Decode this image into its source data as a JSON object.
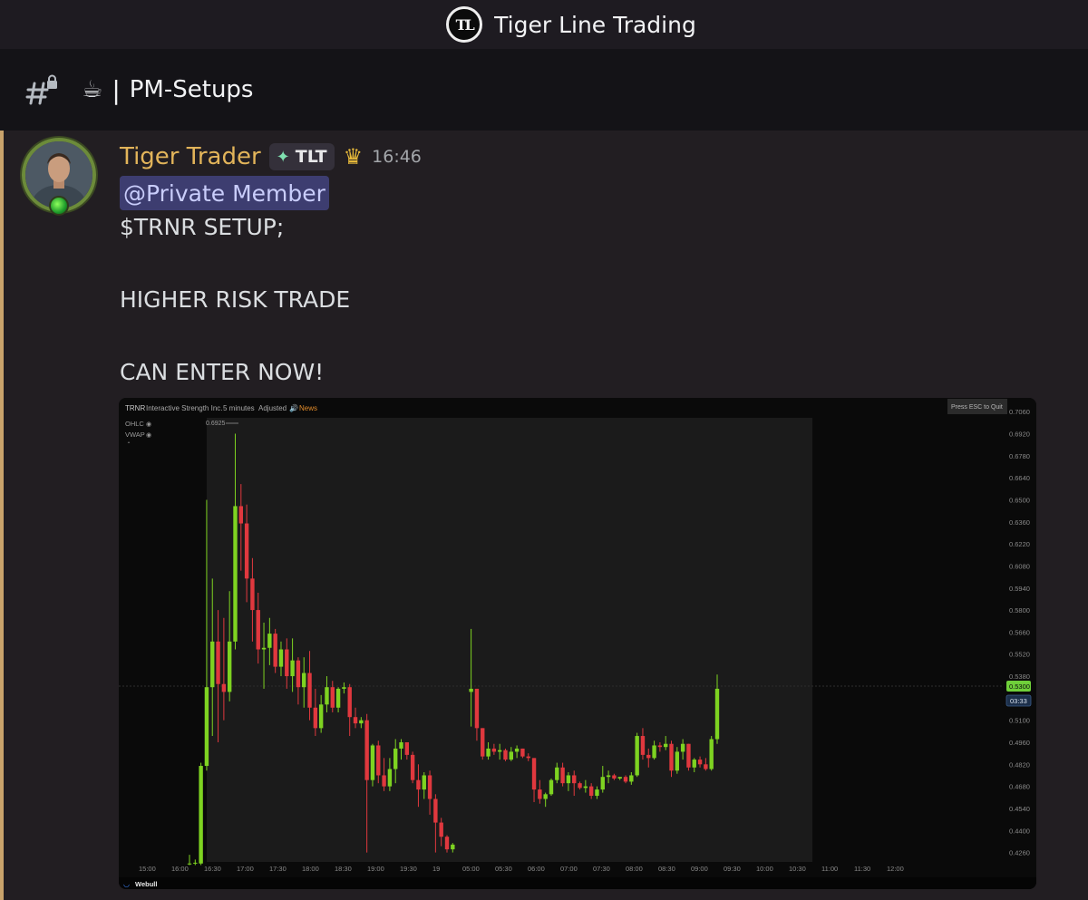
{
  "server": {
    "name": "Tiger Line Trading",
    "logo_text": "TL"
  },
  "channel": {
    "icon": "locked-hash-icon",
    "emoji": "☕",
    "separator": "|",
    "name": "PM-Setups"
  },
  "message": {
    "author": "Tiger Trader",
    "tag": "TLT",
    "timestamp": "16:46",
    "mention": "@Private Member",
    "lines": [
      "$TRNR SETUP;",
      "HIGHER RISK TRADE",
      "CAN ENTER NOW!"
    ]
  },
  "colors": {
    "author": "#e2b45a",
    "mention_bg": "#3d3d70",
    "up": "#7ed321",
    "down": "#e0383e"
  },
  "chart": {
    "symbol": "TRNR",
    "company": "Interactive Strength Inc.",
    "interval": "5 minutes",
    "adjusted": "Adjusted",
    "news": "News",
    "indicators": [
      "OHLC",
      "VWAP"
    ],
    "esc_hint": "Press ESC to Quit",
    "high_marker": "0.6925",
    "last_price": "0.5300",
    "countdown": "03:33",
    "brand": "Webull"
  },
  "chart_data": {
    "type": "candlestick",
    "title": "TRNR",
    "ylim": [
      0.42,
      0.709
    ],
    "y_ticks": [
      "0.7060",
      "0.6920",
      "0.6780",
      "0.6640",
      "0.6500",
      "0.6360",
      "0.6220",
      "0.6080",
      "0.5940",
      "0.5800",
      "0.5660",
      "0.5520",
      "0.5380",
      "0.5100",
      "0.4960",
      "0.4820",
      "0.4680",
      "0.4540",
      "0.4400",
      "0.4260"
    ],
    "x_ticks": [
      "15:00",
      "16:00",
      "16:30",
      "17:00",
      "17:30",
      "18:00",
      "18:30",
      "19:00",
      "19:30",
      "19",
      "05:00",
      "05:30",
      "06:00",
      "07:00",
      "07:30",
      "08:00",
      "08:30",
      "09:00",
      "09:30",
      "10:00",
      "10:30",
      "11:00",
      "11:30",
      "12:00"
    ],
    "candles": [
      {
        "o": 0.419,
        "h": 0.4245,
        "l": 0.418,
        "c": 0.419
      },
      {
        "o": 0.4195,
        "h": 0.4215,
        "l": 0.418,
        "c": 0.4195
      },
      {
        "o": 0.419,
        "h": 0.483,
        "l": 0.418,
        "c": 0.481
      },
      {
        "o": 0.481,
        "h": 0.65,
        "l": 0.478,
        "c": 0.531
      },
      {
        "o": 0.531,
        "h": 0.6,
        "l": 0.5,
        "c": 0.56
      },
      {
        "o": 0.56,
        "h": 0.58,
        "l": 0.496,
        "c": 0.533
      },
      {
        "o": 0.533,
        "h": 0.575,
        "l": 0.51,
        "c": 0.528
      },
      {
        "o": 0.528,
        "h": 0.592,
        "l": 0.522,
        "c": 0.56
      },
      {
        "o": 0.56,
        "h": 0.692,
        "l": 0.555,
        "c": 0.646
      },
      {
        "o": 0.646,
        "h": 0.66,
        "l": 0.605,
        "c": 0.635
      },
      {
        "o": 0.635,
        "h": 0.647,
        "l": 0.585,
        "c": 0.6
      },
      {
        "o": 0.6,
        "h": 0.613,
        "l": 0.56,
        "c": 0.58
      },
      {
        "o": 0.58,
        "h": 0.591,
        "l": 0.546,
        "c": 0.555
      },
      {
        "o": 0.555,
        "h": 0.572,
        "l": 0.53,
        "c": 0.556
      },
      {
        "o": 0.556,
        "h": 0.575,
        "l": 0.545,
        "c": 0.565
      },
      {
        "o": 0.565,
        "h": 0.568,
        "l": 0.54,
        "c": 0.544
      },
      {
        "o": 0.544,
        "h": 0.56,
        "l": 0.538,
        "c": 0.555
      },
      {
        "o": 0.555,
        "h": 0.562,
        "l": 0.53,
        "c": 0.538
      },
      {
        "o": 0.538,
        "h": 0.562,
        "l": 0.528,
        "c": 0.548
      },
      {
        "o": 0.548,
        "h": 0.55,
        "l": 0.52,
        "c": 0.531
      },
      {
        "o": 0.531,
        "h": 0.55,
        "l": 0.518,
        "c": 0.54
      },
      {
        "o": 0.54,
        "h": 0.554,
        "l": 0.51,
        "c": 0.518
      },
      {
        "o": 0.518,
        "h": 0.53,
        "l": 0.5,
        "c": 0.505
      },
      {
        "o": 0.505,
        "h": 0.526,
        "l": 0.502,
        "c": 0.52
      },
      {
        "o": 0.52,
        "h": 0.538,
        "l": 0.515,
        "c": 0.531
      },
      {
        "o": 0.531,
        "h": 0.535,
        "l": 0.515,
        "c": 0.518
      },
      {
        "o": 0.518,
        "h": 0.531,
        "l": 0.515,
        "c": 0.53
      },
      {
        "o": 0.53,
        "h": 0.534,
        "l": 0.527,
        "c": 0.531
      },
      {
        "o": 0.531,
        "h": 0.533,
        "l": 0.5,
        "c": 0.512
      },
      {
        "o": 0.512,
        "h": 0.518,
        "l": 0.505,
        "c": 0.508
      },
      {
        "o": 0.508,
        "h": 0.512,
        "l": 0.505,
        "c": 0.51
      },
      {
        "o": 0.51,
        "h": 0.514,
        "l": 0.426,
        "c": 0.472
      },
      {
        "o": 0.472,
        "h": 0.495,
        "l": 0.468,
        "c": 0.494
      },
      {
        "o": 0.494,
        "h": 0.497,
        "l": 0.47,
        "c": 0.475
      },
      {
        "o": 0.475,
        "h": 0.486,
        "l": 0.465,
        "c": 0.468
      },
      {
        "o": 0.468,
        "h": 0.486,
        "l": 0.465,
        "c": 0.479
      },
      {
        "o": 0.479,
        "h": 0.498,
        "l": 0.47,
        "c": 0.492
      },
      {
        "o": 0.492,
        "h": 0.498,
        "l": 0.485,
        "c": 0.496
      },
      {
        "o": 0.496,
        "h": 0.496,
        "l": 0.485,
        "c": 0.488
      },
      {
        "o": 0.488,
        "h": 0.49,
        "l": 0.47,
        "c": 0.472
      },
      {
        "o": 0.472,
        "h": 0.482,
        "l": 0.455,
        "c": 0.466
      },
      {
        "o": 0.466,
        "h": 0.477,
        "l": 0.46,
        "c": 0.475
      },
      {
        "o": 0.475,
        "h": 0.478,
        "l": 0.45,
        "c": 0.46
      },
      {
        "o": 0.46,
        "h": 0.463,
        "l": 0.426,
        "c": 0.445
      },
      {
        "o": 0.445,
        "h": 0.448,
        "l": 0.43,
        "c": 0.436
      },
      {
        "o": 0.436,
        "h": 0.437,
        "l": 0.426,
        "c": 0.428
      },
      {
        "o": 0.428,
        "h": 0.432,
        "l": 0.426,
        "c": 0.431
      },
      {
        "o": 0.528,
        "h": 0.568,
        "l": 0.506,
        "c": 0.53
      },
      {
        "o": 0.53,
        "h": 0.53,
        "l": 0.497,
        "c": 0.505
      },
      {
        "o": 0.505,
        "h": 0.505,
        "l": 0.485,
        "c": 0.487
      },
      {
        "o": 0.487,
        "h": 0.496,
        "l": 0.485,
        "c": 0.492
      },
      {
        "o": 0.492,
        "h": 0.495,
        "l": 0.488,
        "c": 0.49
      },
      {
        "o": 0.49,
        "h": 0.495,
        "l": 0.485,
        "c": 0.491
      },
      {
        "o": 0.491,
        "h": 0.492,
        "l": 0.484,
        "c": 0.485
      },
      {
        "o": 0.485,
        "h": 0.493,
        "l": 0.484,
        "c": 0.49
      },
      {
        "o": 0.49,
        "h": 0.494,
        "l": 0.486,
        "c": 0.492
      },
      {
        "o": 0.492,
        "h": 0.492,
        "l": 0.486,
        "c": 0.487
      },
      {
        "o": 0.487,
        "h": 0.489,
        "l": 0.484,
        "c": 0.486
      },
      {
        "o": 0.486,
        "h": 0.486,
        "l": 0.458,
        "c": 0.466
      },
      {
        "o": 0.466,
        "h": 0.472,
        "l": 0.457,
        "c": 0.46
      },
      {
        "o": 0.46,
        "h": 0.464,
        "l": 0.455,
        "c": 0.463
      },
      {
        "o": 0.463,
        "h": 0.473,
        "l": 0.462,
        "c": 0.472
      },
      {
        "o": 0.472,
        "h": 0.483,
        "l": 0.47,
        "c": 0.48
      },
      {
        "o": 0.48,
        "h": 0.483,
        "l": 0.468,
        "c": 0.47
      },
      {
        "o": 0.47,
        "h": 0.477,
        "l": 0.465,
        "c": 0.475
      },
      {
        "o": 0.475,
        "h": 0.478,
        "l": 0.462,
        "c": 0.47
      },
      {
        "o": 0.47,
        "h": 0.471,
        "l": 0.466,
        "c": 0.467
      },
      {
        "o": 0.467,
        "h": 0.472,
        "l": 0.464,
        "c": 0.468
      },
      {
        "o": 0.468,
        "h": 0.47,
        "l": 0.46,
        "c": 0.462
      },
      {
        "o": 0.462,
        "h": 0.468,
        "l": 0.46,
        "c": 0.466
      },
      {
        "o": 0.466,
        "h": 0.481,
        "l": 0.464,
        "c": 0.474
      },
      {
        "o": 0.474,
        "h": 0.478,
        "l": 0.47,
        "c": 0.475
      },
      {
        "o": 0.475,
        "h": 0.476,
        "l": 0.472,
        "c": 0.473
      },
      {
        "o": 0.473,
        "h": 0.474,
        "l": 0.472,
        "c": 0.474
      },
      {
        "o": 0.474,
        "h": 0.475,
        "l": 0.47,
        "c": 0.471
      },
      {
        "o": 0.471,
        "h": 0.477,
        "l": 0.469,
        "c": 0.475
      },
      {
        "o": 0.475,
        "h": 0.502,
        "l": 0.474,
        "c": 0.5
      },
      {
        "o": 0.5,
        "h": 0.505,
        "l": 0.485,
        "c": 0.488
      },
      {
        "o": 0.488,
        "h": 0.492,
        "l": 0.48,
        "c": 0.486
      },
      {
        "o": 0.486,
        "h": 0.497,
        "l": 0.485,
        "c": 0.494
      },
      {
        "o": 0.494,
        "h": 0.496,
        "l": 0.49,
        "c": 0.493
      },
      {
        "o": 0.493,
        "h": 0.5,
        "l": 0.491,
        "c": 0.495
      },
      {
        "o": 0.495,
        "h": 0.497,
        "l": 0.474,
        "c": 0.478
      },
      {
        "o": 0.478,
        "h": 0.493,
        "l": 0.476,
        "c": 0.49
      },
      {
        "o": 0.49,
        "h": 0.498,
        "l": 0.485,
        "c": 0.495
      },
      {
        "o": 0.495,
        "h": 0.495,
        "l": 0.478,
        "c": 0.48
      },
      {
        "o": 0.48,
        "h": 0.486,
        "l": 0.477,
        "c": 0.485
      },
      {
        "o": 0.485,
        "h": 0.487,
        "l": 0.48,
        "c": 0.482
      },
      {
        "o": 0.482,
        "h": 0.486,
        "l": 0.478,
        "c": 0.479
      },
      {
        "o": 0.479,
        "h": 0.5,
        "l": 0.478,
        "c": 0.498
      },
      {
        "o": 0.498,
        "h": 0.539,
        "l": 0.495,
        "c": 0.53
      }
    ]
  }
}
